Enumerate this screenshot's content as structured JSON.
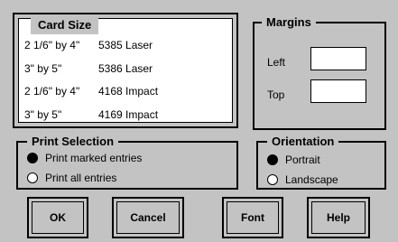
{
  "card_size": {
    "legend": "Card Size",
    "items": [
      {
        "size": "2 1/6\" by 4\"",
        "type": "5385 Laser"
      },
      {
        "size": "3\" by 5\"",
        "type": "5386 Laser"
      },
      {
        "size": "2 1/6\" by 4\"",
        "type": "4168 Impact"
      },
      {
        "size": "3\" by 5\"",
        "type": "4169 Impact"
      }
    ]
  },
  "margins": {
    "legend": "Margins",
    "left_label": "Left",
    "top_label": "Top",
    "left_value": "",
    "top_value": ""
  },
  "print_selection": {
    "legend": "Print Selection",
    "options": [
      {
        "label": "Print marked entries",
        "selected": true
      },
      {
        "label": "Print all entries",
        "selected": false
      }
    ]
  },
  "orientation": {
    "legend": "Orientation",
    "options": [
      {
        "label": "Portrait",
        "selected": true
      },
      {
        "label": "Landscape",
        "selected": false
      }
    ]
  },
  "buttons": {
    "ok": "OK",
    "cancel": "Cancel",
    "font": "Font",
    "help": "Help"
  }
}
